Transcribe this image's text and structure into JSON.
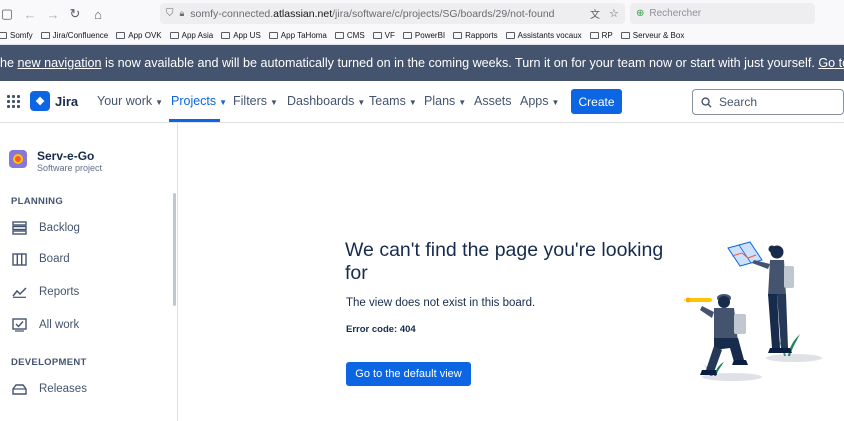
{
  "browser": {
    "url_prefix": "somfy-connected.",
    "url_domain": "atlassian.net",
    "url_path": "/jira/software/c/projects/SG/boards/29/not-found",
    "search_placeholder": "Rechercher"
  },
  "bookmarks": [
    "Somfy",
    "Jira/Confluence",
    "App OVK",
    "App Asia",
    "App US",
    "App TaHoma",
    "CMS",
    "VF",
    "PowerBI",
    "Rapports",
    "Assistants vocaux",
    "RP",
    "Serveur & Box"
  ],
  "banner": {
    "text_before": "he ",
    "link1": "new navigation",
    "text_middle": " is now available and will be automatically turned on in the coming weeks. Turn it on for your team now or start with just yourself. ",
    "link2": "Go to settings"
  },
  "topnav": {
    "product": "Jira",
    "items": [
      {
        "label": "Your work"
      },
      {
        "label": "Projects"
      },
      {
        "label": "Filters"
      },
      {
        "label": "Dashboards"
      },
      {
        "label": "Teams"
      },
      {
        "label": "Plans"
      },
      {
        "label": "Assets"
      },
      {
        "label": "Apps"
      }
    ],
    "create_label": "Create",
    "search_placeholder": "Search"
  },
  "sidebar": {
    "project_name": "Serv-e-Go",
    "project_type": "Software project",
    "planning_heading": "PLANNING",
    "planning_items": [
      "Backlog",
      "Board",
      "Reports",
      "All work"
    ],
    "development_heading": "DEVELOPMENT",
    "development_items": [
      "Releases"
    ]
  },
  "main": {
    "headline": "We can't find the page you're looking for",
    "description": "The view does not exist in this board.",
    "error_code": "Error code: 404",
    "button_label": "Go to the default view"
  },
  "colors": {
    "accent": "#0c66e4",
    "banner_bg": "#44546f"
  }
}
